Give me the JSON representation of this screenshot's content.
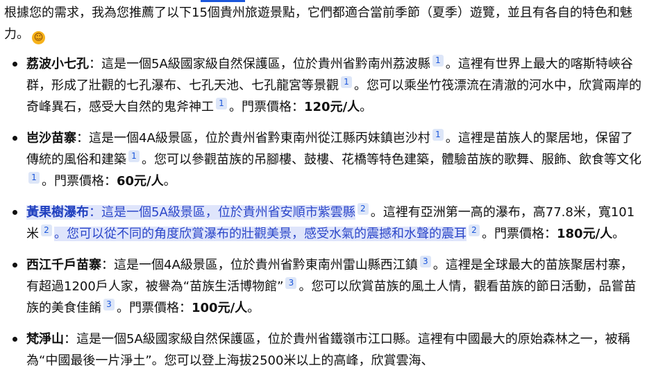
{
  "intro": {
    "text": "根據您的需求，我為您推薦了以下15個貴州旅遊景點，它們都適合當前季節（夏季）遊覽，並且有各自的特色和魅力。",
    "emoji": "smiling-face-emoji"
  },
  "colors": {
    "highlight_bg": "#dfe5fb",
    "highlight_text": "#2b46c9",
    "citation_bg": "#dde6f8",
    "citation_text": "#1a56db"
  },
  "attractions": [
    {
      "name": "荔波小七孔",
      "sep": "：",
      "s1": "這是一個5A級國家級自然保護區，位於貴州省黔南州荔波縣",
      "c1": "1",
      "s2": "。這裡有世界上最大的喀斯特峽谷群，形成了壯觀的七孔瀑布、七孔天池、七孔龍宮等景觀",
      "c2": "1",
      "s3": "。您可以乘坐竹筏漂流在清澈的河水中，欣賞兩岸的奇峰異石，感受大自然的鬼斧神工",
      "c3": "1",
      "price_label": "。門票價格：",
      "price": "120元/人",
      "end": "。"
    },
    {
      "name": "岜沙苗寨",
      "sep": "：",
      "s1": "這是一個4A級景區，位於貴州省黔東南州從江縣丙妹鎮岜沙村",
      "c1": "1",
      "s2": "。這裡是苗族人的聚居地，保留了傳統的風俗和建築",
      "c2": "1",
      "s3": "。您可以參觀苗族的吊腳樓、鼓樓、花橋等特色建築，體驗苗族的歌舞、服飾、飲食等文化",
      "c3": "1",
      "price_label": "。門票價格：",
      "price": "60元/人",
      "end": "。"
    },
    {
      "name": "黃果樹瀑布",
      "sep": "：",
      "s1": "這是一個5A級景區，位於貴州省安順市紫雲縣",
      "c1": "2",
      "s2": "。這裡有亞洲第一高的瀑布，高77.8米，寬101米",
      "c2": "2",
      "s3": "。您可以從不同的角度欣賞瀑布的壯觀美景，感受水氣的震撼和水聲的震耳",
      "c3": "2",
      "price_label": "。門票價格：",
      "price": "180元/人",
      "end": "。"
    },
    {
      "name": "西江千戶苗寨",
      "sep": "：",
      "s1": "這是一個4A級景區，位於貴州省黔東南州雷山縣西江鎮",
      "c1": "3",
      "s2": "。這裡是全球最大的苗族聚居村寨，有超過1200戶人家，被譽為“苗族生活博物館”",
      "c2": "3",
      "s3": "。您可以欣賞苗族的風土人情，觀看苗族的節日活動，品嘗苗族的美食佳餚",
      "c3": "3",
      "price_label": "。門票價格：",
      "price": "100元/人",
      "end": "。"
    },
    {
      "name": "梵淨山",
      "sep": "：",
      "s1": "這是一個5A級國家級自然保護區，位於貴州省鐵嶺市江口縣。這裡有中國最大的原始森林之一，被稱為“中國最後一片淨土”。您可以登上海拔2500米以上的高峰，欣賞雲海、"
    }
  ]
}
